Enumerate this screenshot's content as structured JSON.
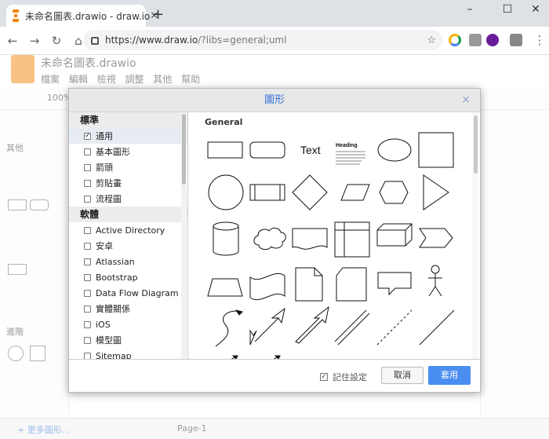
{
  "browser": {
    "tab_title": "未命名圖表.drawio - draw.io",
    "url_main": "https://www.draw.io",
    "url_path": "/?libs=general;uml",
    "new_tab": "+",
    "min": "–",
    "max": "☐",
    "close": "✕",
    "tab_close": "✕"
  },
  "app": {
    "file_name": "未命名圖表.drawio",
    "menus": "檔案 編輯 檢視 調整 其他 幫助",
    "zoom": "100%",
    "side_general": "其他",
    "side_advanced": "進階",
    "more_shapes": "+ 更多圖形...",
    "page_tab": "Page-1"
  },
  "dialog": {
    "title": "圖形",
    "close": "×",
    "categories": [
      {
        "label": "標準",
        "items": [
          {
            "label": "通用",
            "checked": true
          },
          {
            "label": "基本圖形",
            "checked": false
          },
          {
            "label": "箭頭",
            "checked": false
          },
          {
            "label": "剪貼畫",
            "checked": false
          },
          {
            "label": "流程圖",
            "checked": false
          }
        ]
      },
      {
        "label": "軟體",
        "items": [
          {
            "label": "Active Directory",
            "checked": false
          },
          {
            "label": "安卓",
            "checked": false
          },
          {
            "label": "Atlassian",
            "checked": false
          },
          {
            "label": "Bootstrap",
            "checked": false
          },
          {
            "label": "Data Flow Diagram",
            "checked": false
          },
          {
            "label": "實體關係",
            "checked": false
          },
          {
            "label": "iOS",
            "checked": false
          },
          {
            "label": "模型圖",
            "checked": false
          },
          {
            "label": "Sitemap",
            "checked": false
          }
        ]
      }
    ],
    "preview_heading": "General",
    "text_shape_label": "Text",
    "heading_shape_label": "Heading",
    "remember_label": "記住設定",
    "remember_checked": true,
    "cancel_label": "取消",
    "insert_label": "套用"
  },
  "colors": {
    "accent": "#3a74d8",
    "insert_button": "#4b8ef2",
    "drawio_orange": "#f08705"
  }
}
